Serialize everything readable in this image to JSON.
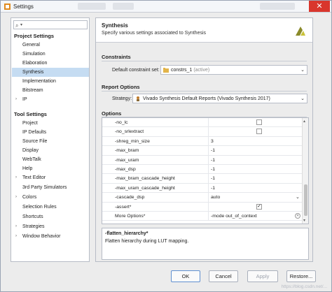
{
  "window": {
    "title": "Settings",
    "close_glyph": "✕",
    "app_icon": "settings-app-icon"
  },
  "nav": {
    "search_placeholder": "Q-",
    "project_settings": {
      "heading": "Project Settings",
      "items": [
        "General",
        "Simulation",
        "Elaboration",
        "Synthesis",
        "Implementation",
        "Bitstream",
        "IP"
      ]
    },
    "tool_settings": {
      "heading": "Tool Settings",
      "items": [
        "Project",
        "IP Defaults",
        "Source File",
        "Display",
        "WebTalk",
        "Help",
        "Text Editor",
        "3rd Party Simulators",
        "Colors",
        "Selection Rules",
        "Shortcuts",
        "Strategies",
        "Window Behavior"
      ]
    },
    "selected": "Synthesis"
  },
  "page": {
    "title": "Synthesis",
    "subtitle": "Specify various settings associated to Synthesis",
    "constraints": {
      "heading": "Constraints",
      "label": "Default constraint set:",
      "value": "constrs_1",
      "value_suffix": "(active)"
    },
    "report_options": {
      "heading": "Report Options",
      "label": "Strategy:",
      "value": "Vivado Synthesis Default Reports (Vivado Synthesis 2017)"
    },
    "options": {
      "heading": "Options",
      "rows": [
        {
          "key": "-no_lc",
          "value": "",
          "control": "checkbox",
          "checked": false
        },
        {
          "key": "-no_srlextract",
          "value": "",
          "control": "checkbox",
          "checked": false
        },
        {
          "key": "-shreg_min_size",
          "value": "3",
          "control": "text"
        },
        {
          "key": "-max_bram",
          "value": "-1",
          "control": "text"
        },
        {
          "key": "-max_uram",
          "value": "-1",
          "control": "text"
        },
        {
          "key": "-max_dsp",
          "value": "-1",
          "control": "text"
        },
        {
          "key": "-max_bram_cascade_height",
          "value": "-1",
          "control": "text"
        },
        {
          "key": "-max_uram_cascade_height",
          "value": "-1",
          "control": "text"
        },
        {
          "key": "-cascade_dsp",
          "value": "auto",
          "control": "dropdown"
        },
        {
          "key": "-assert*",
          "value": "",
          "control": "checkbox",
          "checked": true
        },
        {
          "key": "More Options*",
          "value": "-mode out_of_context",
          "control": "clearable"
        }
      ]
    },
    "description": {
      "title": "-flatten_hierarchy*",
      "text": "Flatten hierarchy during LUT mapping."
    }
  },
  "buttons": {
    "ok": "OK",
    "cancel": "Cancel",
    "apply": "Apply",
    "restore": "Restore..."
  },
  "watermark": "https://blog.csdn.net/..."
}
